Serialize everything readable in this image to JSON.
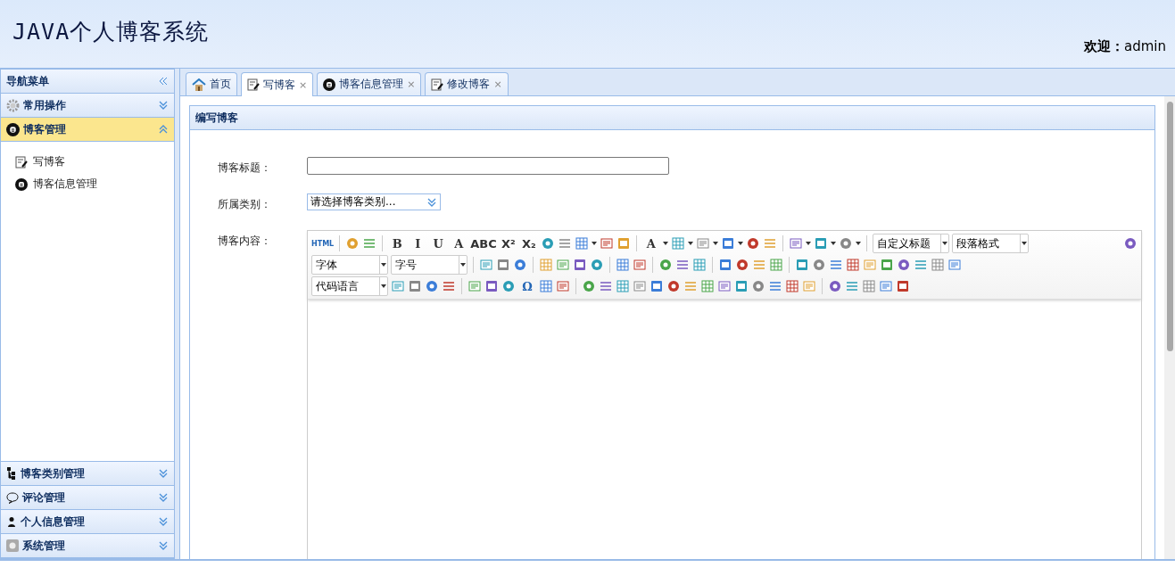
{
  "header": {
    "title": "JAVA个人博客系统",
    "welcome": "**欢迎：**admin"
  },
  "sidebar": {
    "title": "导航菜单",
    "top_panels": [
      {
        "label": "常用操作",
        "expanded": false,
        "selected": false
      },
      {
        "label": "博客管理",
        "expanded": true,
        "selected": true,
        "items": [
          "写博客",
          "博客信息管理"
        ]
      }
    ],
    "bottom_panels": [
      {
        "label": "博客类别管理",
        "expanded": false
      },
      {
        "label": "评论管理",
        "expanded": false
      },
      {
        "label": "个人信息管理",
        "expanded": false
      },
      {
        "label": "系统管理",
        "expanded": false
      }
    ]
  },
  "tabs": [
    {
      "label": "首页",
      "selected": false
    },
    {
      "label": "写博客",
      "selected": true,
      "close": "×"
    },
    {
      "label": "博客信息管理",
      "selected": false,
      "close": "×"
    },
    {
      "label": "修改博客",
      "selected": false,
      "close": "×"
    }
  ],
  "panel": {
    "title": "编写博客",
    "form": {
      "title_label": "博客标题：",
      "category_label": "所属类别：",
      "category_value": "请选择博客类别...",
      "content_label": "博客内容："
    }
  },
  "toolbar": [
    [
      {
        "kind": "glyph",
        "text": "HTML"
      },
      {
        "kind": "sep"
      },
      {
        "kind": "icon"
      },
      {
        "kind": "icon"
      },
      {
        "kind": "sep"
      },
      {
        "kind": "glyph",
        "text": "B"
      },
      {
        "kind": "glyph",
        "text": "I"
      },
      {
        "kind": "glyph",
        "text": "U"
      },
      {
        "kind": "glyph",
        "text": "A"
      },
      {
        "kind": "glyph",
        "text": "ABC"
      },
      {
        "kind": "glyph",
        "text": "X²"
      },
      {
        "kind": "glyph",
        "text": "X₂"
      },
      {
        "kind": "icon"
      },
      {
        "kind": "icon"
      },
      {
        "kind": "icon",
        "caret": true
      },
      {
        "kind": "icon"
      },
      {
        "kind": "icon"
      },
      {
        "kind": "sep"
      },
      {
        "kind": "glyph",
        "text": "A",
        "caret": true
      },
      {
        "kind": "icon",
        "caret": true
      },
      {
        "kind": "icon",
        "caret": true
      },
      {
        "kind": "icon",
        "caret": true
      },
      {
        "kind": "icon"
      },
      {
        "kind": "icon"
      },
      {
        "kind": "sep"
      },
      {
        "kind": "icon",
        "caret": true
      },
      {
        "kind": "icon",
        "caret": true
      },
      {
        "kind": "icon",
        "caret": true
      },
      {
        "kind": "sep"
      },
      {
        "kind": "select",
        "text": "自定义标题"
      },
      {
        "kind": "select",
        "text": "段落格式"
      },
      {
        "kind": "spacer"
      },
      {
        "kind": "icon"
      }
    ],
    [
      {
        "kind": "select",
        "text": "字体"
      },
      {
        "kind": "select",
        "text": "字号"
      },
      {
        "kind": "sep"
      },
      {
        "kind": "icon"
      },
      {
        "kind": "icon"
      },
      {
        "kind": "icon"
      },
      {
        "kind": "sep"
      },
      {
        "kind": "icon"
      },
      {
        "kind": "icon"
      },
      {
        "kind": "icon"
      },
      {
        "kind": "icon"
      },
      {
        "kind": "sep"
      },
      {
        "kind": "icon"
      },
      {
        "kind": "icon"
      },
      {
        "kind": "sep"
      },
      {
        "kind": "icon"
      },
      {
        "kind": "icon"
      },
      {
        "kind": "icon"
      },
      {
        "kind": "sep"
      },
      {
        "kind": "icon"
      },
      {
        "kind": "icon"
      },
      {
        "kind": "icon"
      },
      {
        "kind": "icon"
      },
      {
        "kind": "sep"
      },
      {
        "kind": "icon"
      },
      {
        "kind": "icon"
      },
      {
        "kind": "icon"
      },
      {
        "kind": "icon"
      },
      {
        "kind": "icon"
      },
      {
        "kind": "icon"
      },
      {
        "kind": "icon"
      },
      {
        "kind": "icon"
      },
      {
        "kind": "icon"
      },
      {
        "kind": "icon"
      }
    ],
    [
      {
        "kind": "select",
        "text": "代码语言"
      },
      {
        "kind": "icon"
      },
      {
        "kind": "icon"
      },
      {
        "kind": "icon"
      },
      {
        "kind": "icon"
      },
      {
        "kind": "sep"
      },
      {
        "kind": "icon"
      },
      {
        "kind": "icon"
      },
      {
        "kind": "icon"
      },
      {
        "kind": "glyph",
        "text": "Ω"
      },
      {
        "kind": "icon"
      },
      {
        "kind": "icon"
      },
      {
        "kind": "sep"
      },
      {
        "kind": "icon"
      },
      {
        "kind": "icon"
      },
      {
        "kind": "icon"
      },
      {
        "kind": "icon"
      },
      {
        "kind": "icon"
      },
      {
        "kind": "icon"
      },
      {
        "kind": "icon"
      },
      {
        "kind": "icon"
      },
      {
        "kind": "icon"
      },
      {
        "kind": "icon"
      },
      {
        "kind": "icon"
      },
      {
        "kind": "icon"
      },
      {
        "kind": "icon"
      },
      {
        "kind": "icon"
      },
      {
        "kind": "sep"
      },
      {
        "kind": "icon"
      },
      {
        "kind": "icon"
      },
      {
        "kind": "icon"
      },
      {
        "kind": "icon"
      },
      {
        "kind": "icon"
      }
    ]
  ]
}
